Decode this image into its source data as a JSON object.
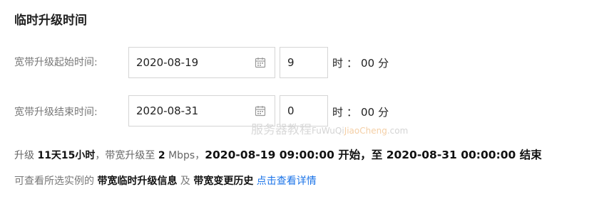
{
  "title": "临时升级时间",
  "start": {
    "label": "宽带升级起始时间:",
    "date": "2020-08-19",
    "hour": "9",
    "hour_unit": "时",
    "colon": "：",
    "minute": "00",
    "minute_unit": "分"
  },
  "end": {
    "label": "宽带升级结束时间:",
    "date": "2020-08-31",
    "hour": "0",
    "hour_unit": "时",
    "colon": "：",
    "minute": "00",
    "minute_unit": "分"
  },
  "watermark": {
    "cn": "服务器教程",
    "latin1": "FuWuQi",
    "latin2": "JiaoCheng",
    "latin3": ".com"
  },
  "summary": {
    "prefix": "升级 ",
    "duration": "11天15小时",
    "mid": "，带宽升级至 ",
    "bandwidth": "2",
    "unit": " Mbps，",
    "start_time": "2020-08-19 09:00:00",
    "start_word": " 开始，至 ",
    "end_time": "2020-08-31 00:00:00",
    "end_word": " 结束"
  },
  "info": {
    "prefix": "可查看所选实例的 ",
    "link1": "带宽临时升级信息",
    "and": " 及 ",
    "link2": "带宽变更历史",
    "details_link": " 点击查看详情"
  },
  "icons": {
    "calendar": "calendar-icon"
  },
  "colors": {
    "link": "#1a73e8",
    "border": "#d5d5d5"
  }
}
